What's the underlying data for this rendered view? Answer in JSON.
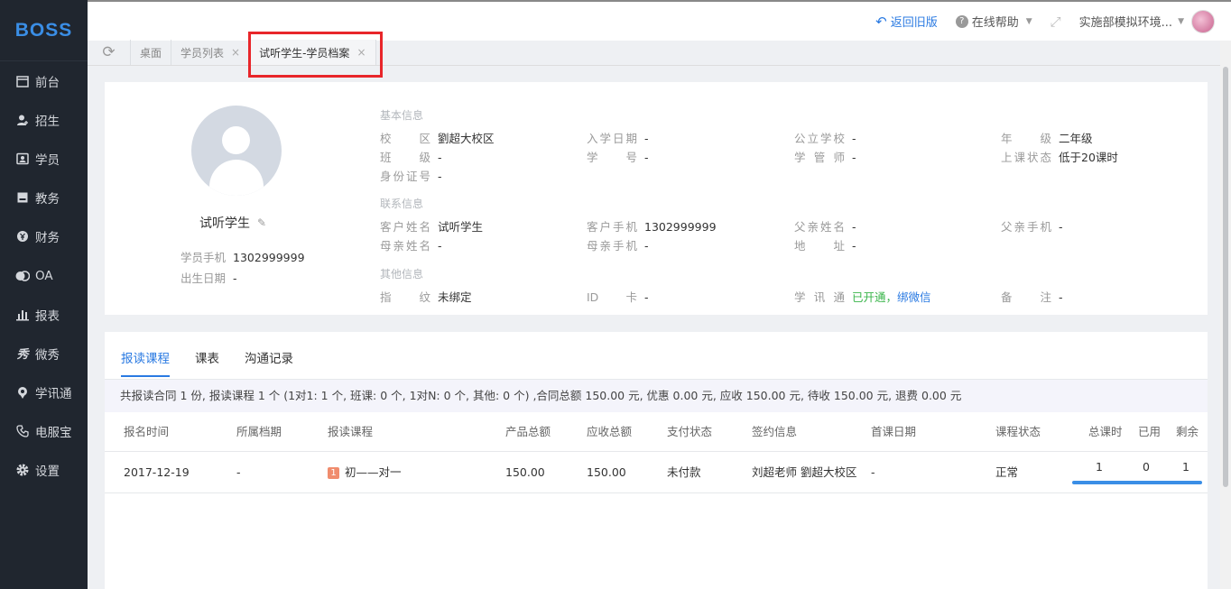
{
  "brand": "BOSS",
  "nav": [
    {
      "label": "前台",
      "icon": "calendar-icon"
    },
    {
      "label": "招生",
      "icon": "user-plus-icon"
    },
    {
      "label": "学员",
      "icon": "id-card-icon"
    },
    {
      "label": "教务",
      "icon": "book-icon"
    },
    {
      "label": "财务",
      "icon": "yen-icon"
    },
    {
      "label": "OA",
      "icon": "toggle-icon"
    },
    {
      "label": "报表",
      "icon": "bar-chart-icon"
    },
    {
      "label": "微秀",
      "icon": "xiu-icon"
    },
    {
      "label": "学讯通",
      "icon": "location-icon"
    },
    {
      "label": "电服宝",
      "icon": "phone-icon"
    },
    {
      "label": "设置",
      "icon": "gear-icon"
    }
  ],
  "topbar": {
    "back": "返回旧版",
    "help": "在线帮助",
    "user": "实施部模拟环境..."
  },
  "tabs": [
    {
      "label": "桌面",
      "closable": false
    },
    {
      "label": "学员列表",
      "closable": true
    },
    {
      "label": "试听学生-学员档案",
      "closable": true
    }
  ],
  "profile": {
    "name": "试听学生",
    "phone_label": "学员手机",
    "phone": "1302999999",
    "birth_label": "出生日期",
    "birth": "-"
  },
  "sections": {
    "basic": "基本信息",
    "contact": "联系信息",
    "other": "其他信息"
  },
  "basic": {
    "campus": {
      "label": "校区",
      "value": "劉超大校区"
    },
    "enroll_date": {
      "label": "入学日期",
      "value": "-"
    },
    "public_school": {
      "label": "公立学校",
      "value": "-"
    },
    "grade": {
      "label": "年级",
      "value": "二年级"
    },
    "class": {
      "label": "班级",
      "value": "-"
    },
    "student_no": {
      "label": "学号",
      "value": "-"
    },
    "manager": {
      "label": "学管师",
      "value": "-"
    },
    "status": {
      "label": "上课状态",
      "value": "低于20课时"
    },
    "id_no": {
      "label": "身份证号",
      "value": "-"
    }
  },
  "contact": {
    "cust_name": {
      "label": "客户姓名",
      "value": "试听学生"
    },
    "cust_phone": {
      "label": "客户手机",
      "value": "1302999999"
    },
    "father_name": {
      "label": "父亲姓名",
      "value": "-"
    },
    "father_phone": {
      "label": "父亲手机",
      "value": "-"
    },
    "mother_name": {
      "label": "母亲姓名",
      "value": "-"
    },
    "mother_phone": {
      "label": "母亲手机",
      "value": "-"
    },
    "address": {
      "label": "地址",
      "value": "-"
    }
  },
  "other": {
    "fingerprint": {
      "label": "指纹",
      "value": "未绑定"
    },
    "id_card": {
      "label": "ID卡",
      "value": "-"
    },
    "xuexuntong": {
      "label": "学讯通",
      "value": "已开通",
      "sep": "，",
      "link": "绑微信"
    },
    "remark": {
      "label": "备注",
      "value": "-"
    }
  },
  "detail_tabs": [
    "报读课程",
    "课表",
    "沟通记录"
  ],
  "summary": "共报读合同 1 份, 报读课程 1 个 (1对1: 1 个, 班课: 0 个, 1对N: 0 个, 其他: 0 个) ,合同总额 150.00 元, 优惠 0.00 元, 应收 150.00 元, 待收 150.00 元, 退费 0.00 元",
  "table": {
    "headers": [
      "报名时间",
      "所属档期",
      "报读课程",
      "产品总额",
      "应收总额",
      "支付状态",
      "签约信息",
      "首课日期",
      "课程状态",
      "总课时",
      "已用",
      "剩余"
    ],
    "rows": [
      {
        "date": "2017-12-19",
        "period": "-",
        "badge": "1",
        "course": "初——对一",
        "product_total": "150.00",
        "receivable": "150.00",
        "pay_status": "未付款",
        "sign": "刘超老师 劉超大校区",
        "first_date": "-",
        "course_status": "正常",
        "total": "1",
        "used": "0",
        "left": "1",
        "progress": 1
      }
    ]
  }
}
